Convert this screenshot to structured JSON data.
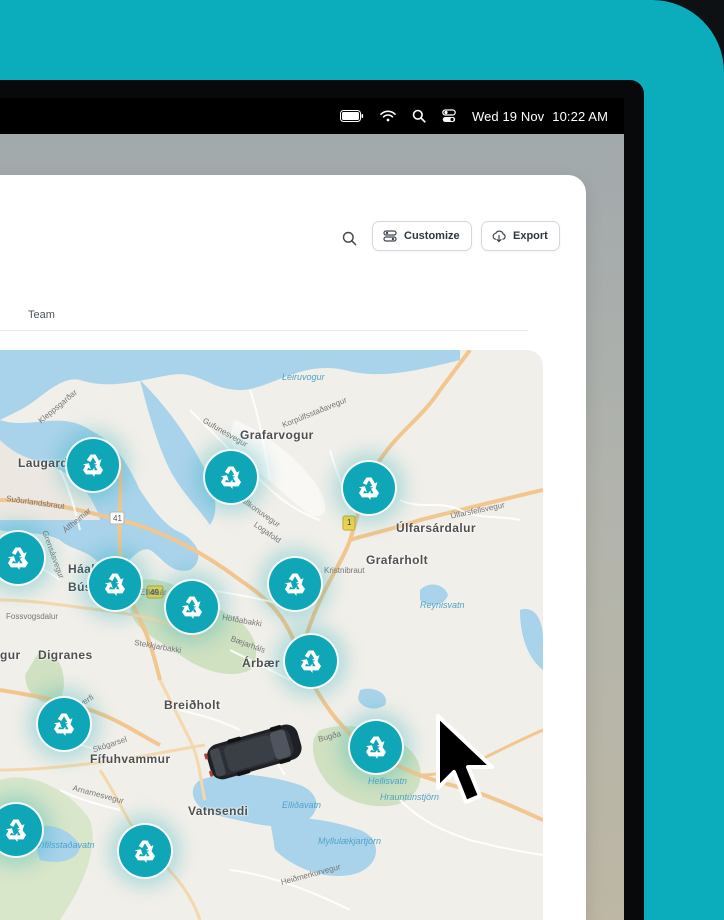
{
  "menubar": {
    "date": "Wed 19 Nov",
    "time": "10:22 AM",
    "icons": [
      "battery-icon",
      "wifi-icon",
      "search-icon",
      "control-center-icon"
    ]
  },
  "toolbar": {
    "search_icon": "search-icon",
    "customize_label": "Customize",
    "export_label": "Export"
  },
  "tabs": {
    "team_label": "Team"
  },
  "map": {
    "places": {
      "grafarvogur": "Grafarvogur",
      "laugard": "Laugard",
      "ulfarsardalur": "Úlfarsárdalur",
      "grafarholt": "Grafarholt",
      "haal": "Háal",
      "bus": "Bús",
      "digranes": "Digranes",
      "gur": "gur",
      "arbaer": "Árbær",
      "breidholt": "Breiðholt",
      "fifuhvammur": "Fífuhvammur",
      "vatnsendi": "Vatnsendi"
    },
    "streets": {
      "leiruvogur": "Leiruvogur",
      "kleppsgar": "Kleppsgarðar",
      "gufunesvegur": "Gufunesvegur",
      "korpulfs": "Korpúlfsstaðavegur",
      "ulfarsfellsvegur": "Úlfarsfellsvegur",
      "sudurlandsbraut": "Suðurlandsbraut",
      "alfheimar": "Álfheimar",
      "grensasvegur": "Grensásvegur",
      "fossvogsdalur": "Fossvogsdalur",
      "hjallahverfi": "Hjallahverfi",
      "skogarsel": "Skógarsel",
      "amarnesvegur": "Arnarnesvegur",
      "bugda": "Bugða",
      "kristnibraut": "Kristnibraut",
      "baejarhals": "Bæjarháls",
      "hofdabakki": "Höfðabakki",
      "stekkjarbakki": "Stekkjarbakki",
      "fjallkonuvegur": "Fjallkonuvegur",
      "logafold": "Logafold",
      "hraunt": "Hrauntúnstjörn",
      "hellisvatn": "Hellisvatn",
      "reynisvatn": "Reynisvatn",
      "ellidavatn": "Elliðavatn",
      "vifilsstadavatn": "Vífilsstaðavatn",
      "myllu": "Myllulækjartjörn",
      "heidmerk": "Heiðmerkurvegur",
      "road_41": "41",
      "road_49": "49",
      "road_1": "1",
      "ellidaar": "Elliðaár"
    },
    "pins": [
      {
        "name": "recycle-pin-laugardalur",
        "icon": "recycle-icon"
      },
      {
        "name": "recycle-pin-grafarvogur",
        "icon": "recycle-icon"
      },
      {
        "name": "recycle-pin-grafarholt",
        "icon": "recycle-icon"
      },
      {
        "name": "recycle-pin-west",
        "icon": "recycle-icon"
      },
      {
        "name": "recycle-pin-haaleiti",
        "icon": "recycle-icon"
      },
      {
        "name": "recycle-pin-ellidaar",
        "icon": "recycle-icon"
      },
      {
        "name": "recycle-pin-arbaer-north",
        "icon": "recycle-icon"
      },
      {
        "name": "recycle-pin-arbaer",
        "icon": "recycle-icon"
      },
      {
        "name": "recycle-pin-kopavogur",
        "icon": "recycle-icon"
      },
      {
        "name": "recycle-pin-hellisheidi",
        "icon": "recycle-icon"
      },
      {
        "name": "recycle-pin-southwest",
        "icon": "recycle-icon"
      },
      {
        "name": "recycle-pin-vatnsendi",
        "icon": "recycle-icon"
      }
    ],
    "vehicle_icon": "car-icon",
    "cursor_icon": "mouse-pointer-icon"
  },
  "colors": {
    "brand_teal": "#0badbd",
    "pin_teal": "#0fa7b8",
    "water": "#a9d3ea",
    "park": "#cfe1c0",
    "road": "#f2c68f"
  }
}
